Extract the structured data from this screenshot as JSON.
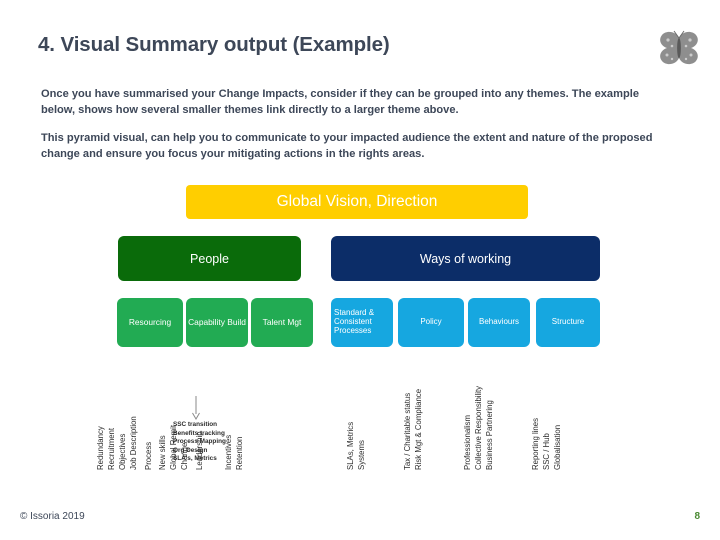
{
  "slide": {
    "title": "4. Visual Summary output (Example)",
    "logo_icon": "butterfly-logo-icon",
    "paragraphs": [
      "Once you have summarised your Change Impacts, consider if they can be grouped into any themes. The example below, shows how several smaller themes link directly to a larger theme above.",
      "This pyramid visual, can help you to communicate to your impacted audience the extent and nature of the proposed change and ensure you focus your mitigating actions in the rights areas."
    ]
  },
  "colors": {
    "vision": "#ffce00",
    "people": "#0a6b0a",
    "ways_of_working": "#0c2d68",
    "people_sub": "#22ab53",
    "ways_sub": "#16a7e0",
    "title_text": "#3d4758",
    "page_number": "#4a8a32"
  },
  "diagram": {
    "tier1": {
      "label": "Global Vision, Direction"
    },
    "tier2": [
      {
        "label": "People"
      },
      {
        "label": "Ways of working"
      }
    ],
    "tier3": [
      {
        "label": "Resourcing"
      },
      {
        "label": "Capability Build"
      },
      {
        "label": "Talent Mgt"
      },
      {
        "label": "Standard & Consistent Processes"
      },
      {
        "label": "Policy"
      },
      {
        "label": "Behaviours"
      },
      {
        "label": "Structure"
      }
    ],
    "impacts": [
      {
        "label": "Redundancy"
      },
      {
        "label": "Recruitment"
      },
      {
        "label": "Objectives"
      },
      {
        "label": "Job Description"
      },
      {
        "label": "Process"
      },
      {
        "label": "New skills"
      },
      {
        "label": "Global Remit"
      },
      {
        "label": "Change"
      },
      {
        "label": "Leadership"
      },
      {
        "label": "Incentives"
      },
      {
        "label": "Retention"
      },
      {
        "label": "SLAs, Metrics"
      },
      {
        "label": "Systems"
      },
      {
        "label": "Tax / Charitable status"
      },
      {
        "label": "Risk Mgt & Compliance"
      },
      {
        "label": "Professionalism"
      },
      {
        "label": "Collective Responsibility"
      },
      {
        "label": "Business Partnering"
      },
      {
        "label": "Reporting lines"
      },
      {
        "label": "SSC / Hub"
      },
      {
        "label": "Globalisation"
      }
    ],
    "sublist": [
      "SSC transition",
      "Benefits tracking",
      "Process Mapping",
      "Org Design",
      "SLA's, Metrics"
    ]
  },
  "footer": {
    "copyright": "© Issoria 2019",
    "page_number": "8"
  }
}
